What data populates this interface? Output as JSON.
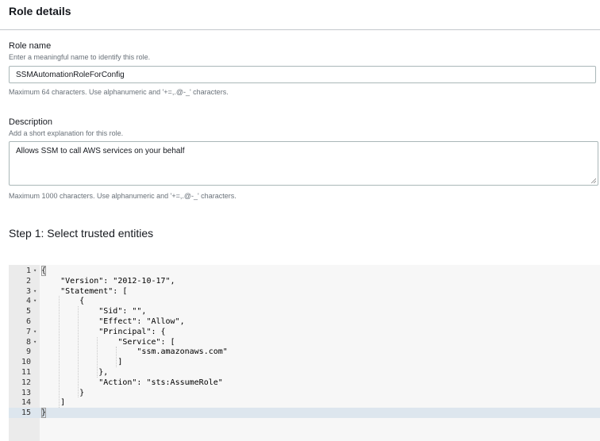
{
  "role_details": {
    "title": "Role details",
    "role_name": {
      "label": "Role name",
      "hint": "Enter a meaningful name to identify this role.",
      "value": "SSMAutomationRoleForConfig",
      "constraint": "Maximum 64 characters. Use alphanumeric and '+=,.@-_' characters."
    },
    "description": {
      "label": "Description",
      "hint": "Add a short explanation for this role.",
      "value": "Allows SSM to call AWS services on your behalf",
      "constraint": "Maximum 1000 characters. Use alphanumeric and '+=,.@-_' characters."
    }
  },
  "step1": {
    "title": "Step 1: Select trusted entities"
  },
  "editor": {
    "active_line": 15,
    "lines": [
      {
        "num": "1",
        "fold": true,
        "text": "{"
      },
      {
        "num": "2",
        "fold": false,
        "text": "    \"Version\": \"2012-10-17\","
      },
      {
        "num": "3",
        "fold": true,
        "text": "    \"Statement\": ["
      },
      {
        "num": "4",
        "fold": true,
        "text": "        {"
      },
      {
        "num": "5",
        "fold": false,
        "text": "            \"Sid\": \"\","
      },
      {
        "num": "6",
        "fold": false,
        "text": "            \"Effect\": \"Allow\","
      },
      {
        "num": "7",
        "fold": true,
        "text": "            \"Principal\": {"
      },
      {
        "num": "8",
        "fold": true,
        "text": "                \"Service\": ["
      },
      {
        "num": "9",
        "fold": false,
        "text": "                    \"ssm.amazonaws.com\""
      },
      {
        "num": "10",
        "fold": false,
        "text": "                ]"
      },
      {
        "num": "11",
        "fold": false,
        "text": "            },"
      },
      {
        "num": "12",
        "fold": false,
        "text": "            \"Action\": \"sts:AssumeRole\""
      },
      {
        "num": "13",
        "fold": false,
        "text": "        }"
      },
      {
        "num": "14",
        "fold": false,
        "text": "    ]"
      },
      {
        "num": "15",
        "fold": false,
        "text": "}"
      }
    ]
  }
}
